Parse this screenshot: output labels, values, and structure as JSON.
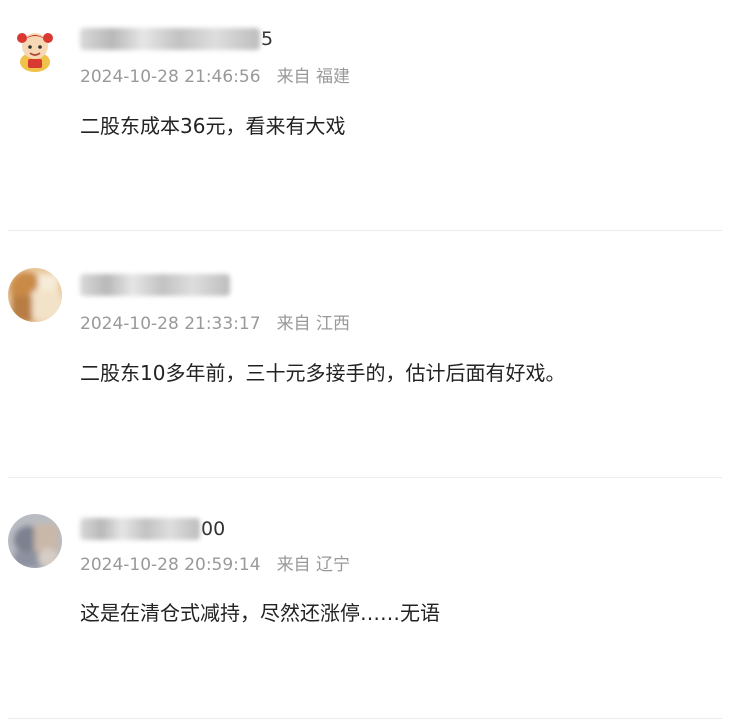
{
  "comments": [
    {
      "username_suffix": "5",
      "timestamp": "2024-10-28 21:46:56",
      "location": "来自 福建",
      "text": "二股东成本36元，看来有大戏"
    },
    {
      "username_suffix": "",
      "timestamp": "2024-10-28 21:33:17",
      "location": "来自 江西",
      "text": "二股东10多年前，三十元多接手的，估计后面有好戏。"
    },
    {
      "username_suffix": "00",
      "timestamp": "2024-10-28 20:59:14",
      "location": "来自 辽宁",
      "text": "这是在清仓式减持，尽然还涨停……无语"
    }
  ],
  "colors": {
    "meta_text": "#999999",
    "content_text": "#222222",
    "divider": "#ececec"
  }
}
